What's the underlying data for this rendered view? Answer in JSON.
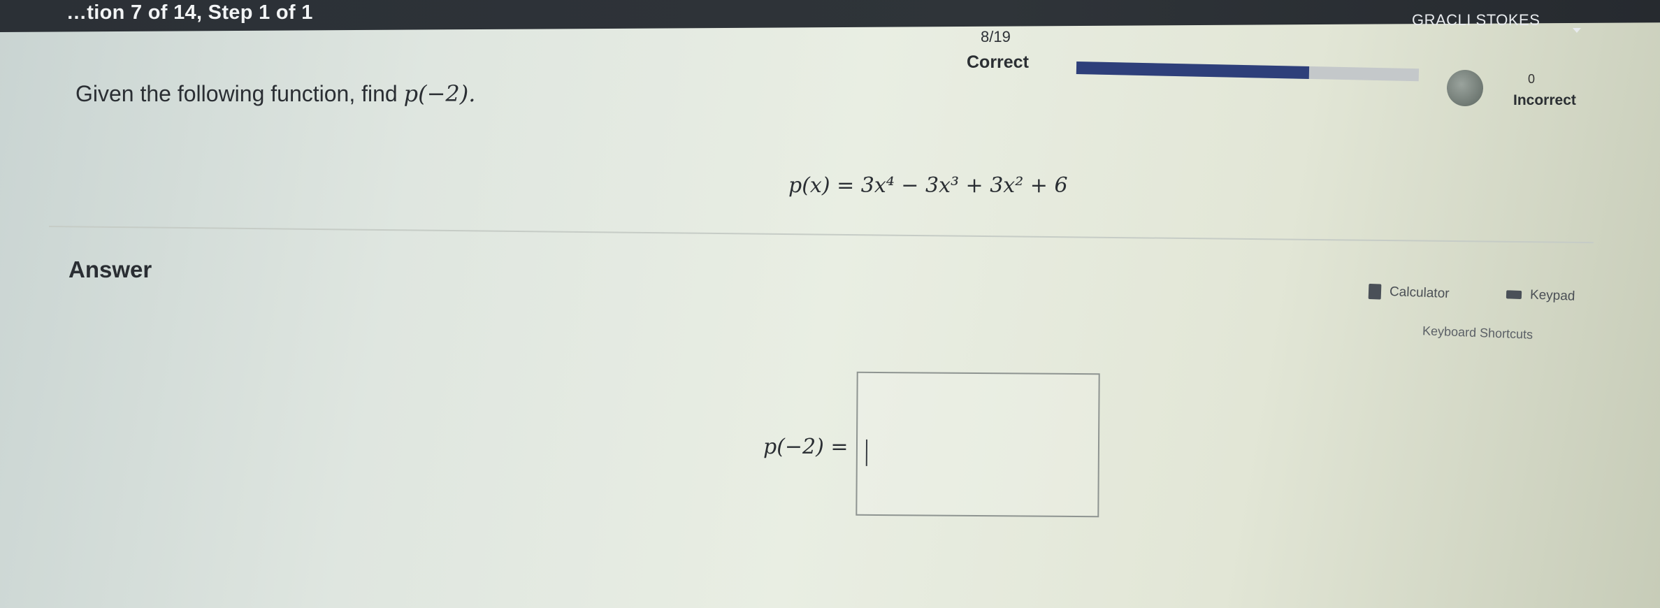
{
  "header": {
    "title": "…tion 7 of 14, Step 1 of 1",
    "user_name": "GRACLI STOKES"
  },
  "progress": {
    "count": "8/19",
    "correct_label": "Correct",
    "fraction": 0.68,
    "incorrect_count": "0",
    "incorrect_label": "Incorrect"
  },
  "question": {
    "prompt": "Given the following function, find ",
    "prompt_math": "p(−2).",
    "function": "p(x) = 3x⁴ − 3x³ + 3x² + 6"
  },
  "answer": {
    "heading": "Answer",
    "calculator_label": "Calculator",
    "keypad_label": "Keypad",
    "shortcuts_label": "Keyboard Shortcuts",
    "input_label": "p(−2) =",
    "input_value": ""
  }
}
